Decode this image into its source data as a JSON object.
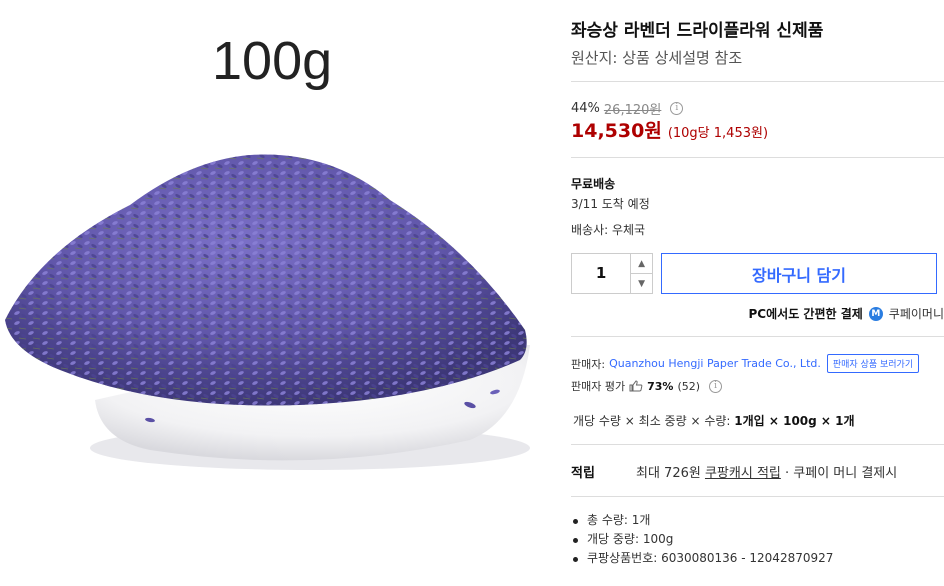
{
  "image": {
    "caption": "100g",
    "alt": "dried lavender flowers on a white plate"
  },
  "product": {
    "title": "좌승상 라벤더 드라이플라워 신제품",
    "origin": "원산지: 상품 상세설명 참조"
  },
  "pricing": {
    "discount_pct": "44%",
    "original_price": "26,120원",
    "price": "14,530원",
    "unit_price": "(10g당 1,453원)"
  },
  "shipping": {
    "title": "무료배송",
    "arrival": "3/11 도착 예정",
    "carrier": "배송사: 우체국"
  },
  "purchase": {
    "quantity": "1",
    "cart_button": "장바구니 담기",
    "pc_pay_text": "PC에서도 간편한 결제",
    "pay_icon": "M",
    "pay_name": "쿠페이머니"
  },
  "seller": {
    "label": "판매자:",
    "name": "Quanzhou Hengji Paper Trade Co., Ltd.",
    "more_button": "판매자 상품 보러가기",
    "rating_label": "판매자 평가",
    "rating_pct": "73%",
    "rating_count": "(52)"
  },
  "quantity_info": {
    "prefix": "개당 수량 × 최소 중량 × 수량: ",
    "value": "1개입 × 100g × 1개"
  },
  "reward": {
    "label": "적립",
    "text_prefix": "최대 726원 ",
    "link": "쿠팡캐시 적립",
    "text_suffix": " · 쿠페이 머니 결제시"
  },
  "details": [
    "총 수량: 1개",
    "개당 중량: 100g",
    "쿠팡상품번호: 6030080136 - 12042870927"
  ],
  "colors": {
    "price_red": "#ae0000",
    "accent_blue": "#346aff",
    "lavender": "#6f63b8"
  }
}
